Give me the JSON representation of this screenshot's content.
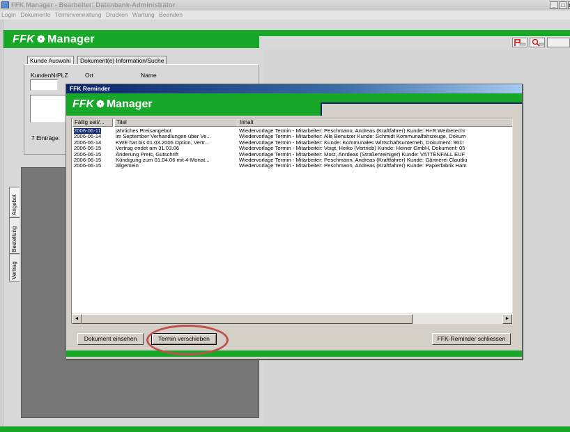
{
  "window": {
    "title": "FFK Manager - Bearbeiter: Datenbank-Administrator",
    "controls": [
      "_",
      "□",
      "x"
    ]
  },
  "menu": [
    "Login",
    "Dokumente",
    "Terminverwaltung",
    "Drucken",
    "Wartung",
    "Beenden"
  ],
  "logo": {
    "brand": "FFK",
    "name": "Manager"
  },
  "customer_panel": {
    "tabs": [
      "Kunde Auswahl",
      "Dokument(e) Information/Suche"
    ],
    "field_labels": {
      "number": "KundenNr.",
      "zip": "PLZ",
      "city": "Ort",
      "name": "Name"
    },
    "entries_label": "7 Einträge:"
  },
  "side_tabs": [
    "Angebot",
    "Bestellung",
    "Vertrag"
  ],
  "reminder": {
    "title": "FFK Reminder",
    "columns": [
      "Fällig seit/...",
      "Titel",
      "Inhalt"
    ],
    "rows": [
      {
        "date": "2006-06-11",
        "title": "jährliches Preisangebot",
        "content": "Wiedervorlage Termin - Mitarbeiter: Peschmann, Andreas (Kraftfahrer) Kunde: H+R Werbetechr"
      },
      {
        "date": "2006-06-14",
        "title": "im September Verhandlungen über Ve...",
        "content": "Wiedervorlage Termin - Mitarbeiter: Alle Benutzer Kunde: Schmidt Kommunalfahrzeuge, Dokum"
      },
      {
        "date": "2006-06-14",
        "title": "KWE hat bis 01.03.2006 Option, Vertr...",
        "content": "Wiedervorlage Termin - Mitarbeiter:  Kunde: Kommunales Wirtschaftsunterneh, Dokument: 961!"
      },
      {
        "date": "2006-06-15",
        "title": "Vertrag endet am 31.03.06",
        "content": "Wiedervorlage Termin - Mitarbeiter: Voigt, Heiko (Vertrieb) Kunde: Heiner GmbH, Dokument: 05"
      },
      {
        "date": "2006-06-15",
        "title": "Änderung Preis, Gutschrift",
        "content": "Wiedervorlage Termin - Mitarbeiter: Motz, Anrdeas (Straßenreiniger) Kunde: VATTENFALL EUF"
      },
      {
        "date": "2006-06-15",
        "title": "Kündigung zum 01.04.06 mit 4-Monat...",
        "content": "Wiedervorlage Termin - Mitarbeiter: Peschmann, Andreas (Kraftfahrer) Kunde: Gärtnerei Claudiu"
      },
      {
        "date": "2006-06-15",
        "title": "allgemein",
        "content": "Wiedervorlage Termin - Mitarbeiter: Peschmann, Andreas (Kraftfahrer) Kunde: Papierfabrik Ham"
      }
    ],
    "buttons": {
      "view": "Dokument einsehen",
      "postpone": "Termin verschieben",
      "close": "FFK-Reminder schliessen"
    },
    "scroll_left": "◄",
    "scroll_right": "►"
  },
  "colors": {
    "brand_green": "#17a82a",
    "dialog_face": "#d4d0c8",
    "selection": "#0a246a",
    "highlight_ring": "#c0504d"
  }
}
